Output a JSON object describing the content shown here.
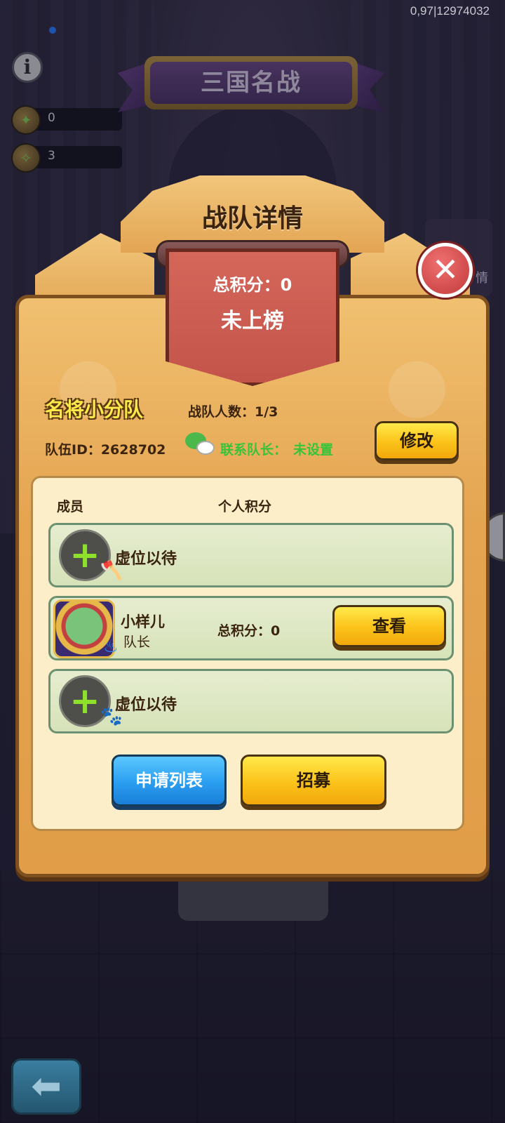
{
  "status": {
    "text": "0,97|12974032"
  },
  "hud": {
    "info_glyph": "i",
    "resources": [
      {
        "icon": "coin-bag-icon",
        "value": "0"
      },
      {
        "icon": "ticket-icon",
        "value": "3"
      }
    ],
    "banner_title": "三国名战"
  },
  "modal": {
    "title": "战队详情",
    "total_score": "总积分：0",
    "rank_status": "未上榜",
    "team_name": "名将小分队",
    "member_count": "战队人数：1/3",
    "team_id": "队伍ID：2628702",
    "contact_label": "联系队长：",
    "contact_value": "未设置",
    "edit_button": "修改",
    "columns": {
      "member": "成员",
      "personal_score": "个人积分"
    },
    "slots": [
      {
        "type": "empty",
        "label": "虚位以待",
        "tag_icon": "axe-icon"
      },
      {
        "type": "member",
        "name": "小样儿",
        "role": "队长",
        "score": "总积分：0",
        "action": "查看"
      },
      {
        "type": "empty",
        "label": "虚位以待",
        "tag_icon": "paw-icon"
      }
    ],
    "apply_list_button": "申请列表",
    "recruit_button": "招募"
  },
  "colors": {
    "team_name": "#ffe94a",
    "contact": "#37c43a",
    "flag": "#c85a4e",
    "panel": "#e4a450"
  }
}
